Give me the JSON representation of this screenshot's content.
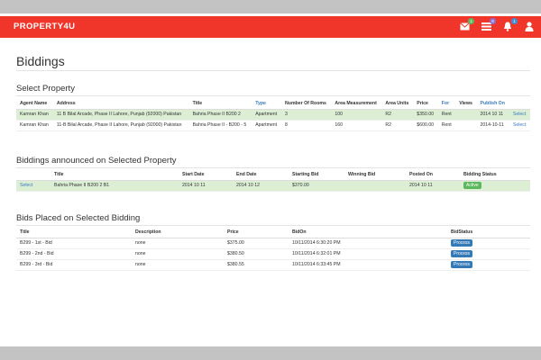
{
  "app": {
    "brand": "PROPERTY4U"
  },
  "nav_icons": [
    {
      "name": "envelope-icon",
      "badge": "1",
      "badge_color": "#5cb85c"
    },
    {
      "name": "list-icon",
      "badge": "8",
      "badge_color": "#8e6fd1"
    },
    {
      "name": "bell-icon",
      "badge": "1",
      "badge_color": "#3a8fd9"
    },
    {
      "name": "user-icon",
      "badge": ""
    }
  ],
  "page": {
    "title": "Biddings"
  },
  "select_property": {
    "heading": "Select Property",
    "columns": [
      "Agent Name",
      "Address",
      "Title",
      "Type",
      "Number Of Rooms",
      "Area Measurement",
      "Area Units",
      "Price",
      "For",
      "Views",
      "Publish On",
      ""
    ],
    "rows": [
      [
        "Kamran Khan",
        "11 B Bilal Arcade, Phase II Lahore, Punjab (92000) Pakistan",
        "Bahria Phase II B200 2",
        "Apartment",
        "3",
        "100",
        "R2",
        "$350.00",
        "Rent",
        "",
        "2014 10 11",
        "Select"
      ],
      [
        "Kamran Khan",
        "11-B Bilal Arcade, Phase II Lahore, Punjab (92000) Pakistan",
        "Bahria Phase II - B200 - 5",
        "Apartment",
        "8",
        "160",
        "R2",
        "$600.00",
        "Rent",
        "",
        "2014-10-11",
        "Select"
      ]
    ]
  },
  "announced": {
    "heading": "Biddings announced on Selected Property",
    "columns": [
      "",
      "Title",
      "Start Date",
      "End Date",
      "Starting Bid",
      "Winning Bid",
      "Posted On",
      "Bidding Status"
    ],
    "rows": [
      [
        "Select",
        "Bahria Phase II B200 2 B1",
        "2014 10 11",
        "2014 10 12",
        "$370.00",
        "",
        "2014 10 11",
        "Active"
      ]
    ]
  },
  "bids": {
    "heading": "Bids Placed on Selected Bidding",
    "columns": [
      "Title",
      "Description",
      "Price",
      "BidOn",
      "BidStatus"
    ],
    "rows": [
      [
        "B299 - 1st - Bid",
        "none",
        "$375.00",
        "10/11/2014 6:30:20 PM",
        "Process"
      ],
      [
        "B299 - 2nd - Bid",
        "none",
        "$380.50",
        "10/11/2014 6:32:01 PM",
        "Process"
      ],
      [
        "B299 - 3rd - Bid",
        "none",
        "$380.55",
        "10/11/2014 6:33:45 PM",
        "Process"
      ]
    ]
  },
  "colors": {
    "navbar": "#f0362a",
    "row_highlight": "#dcefd5",
    "link": "#3a7bbf",
    "active": "#5cb85c",
    "process": "#337ab7"
  }
}
